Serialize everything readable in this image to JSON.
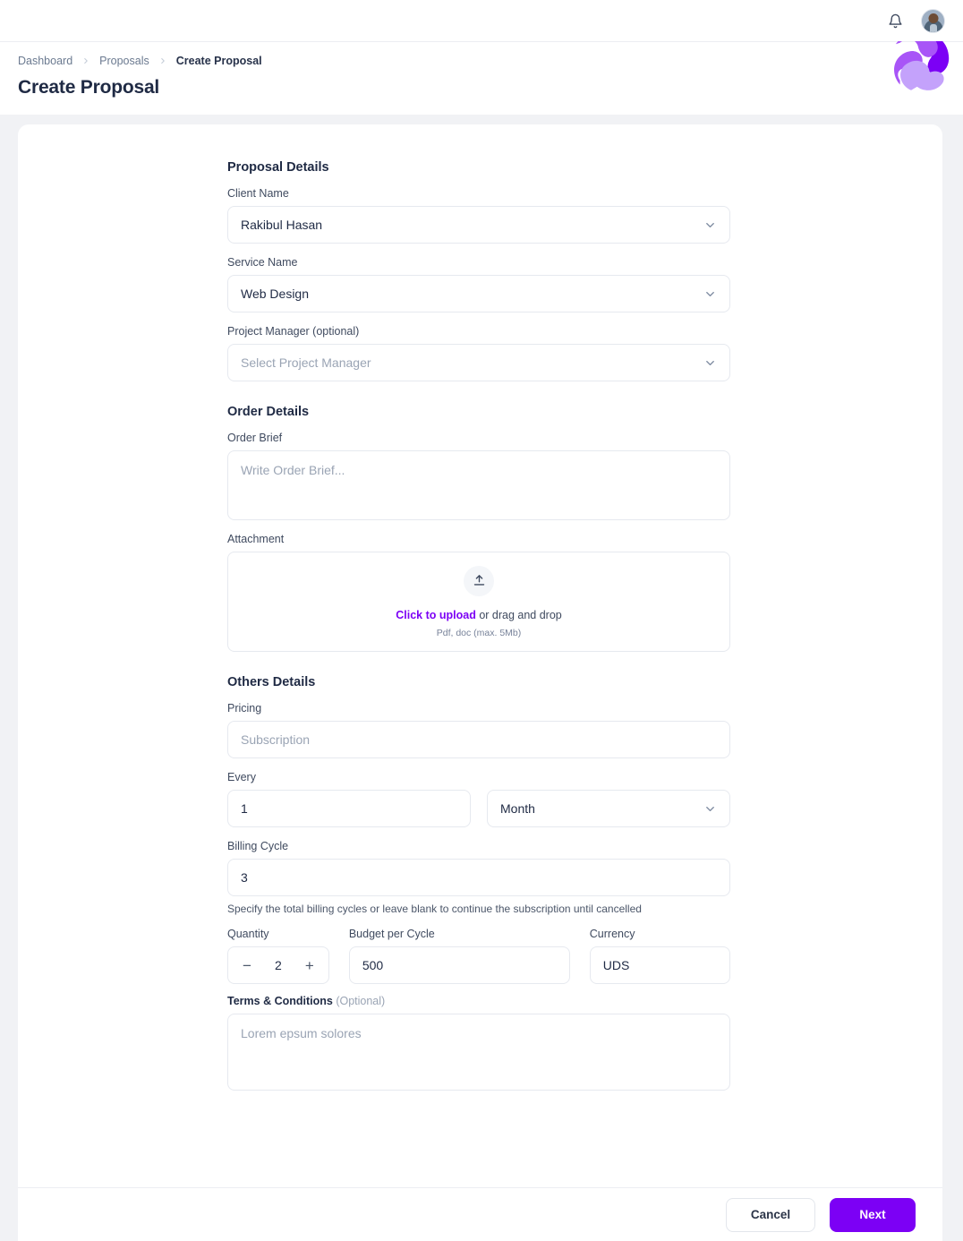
{
  "topbar": {
    "bell_icon": "bell-icon",
    "avatar_label": "user-avatar"
  },
  "header": {
    "breadcrumb": [
      {
        "label": "Dashboard",
        "current": false
      },
      {
        "label": "Proposals",
        "current": false
      },
      {
        "label": "Create Proposal",
        "current": true
      }
    ],
    "title": "Create Proposal",
    "logo": "brand-logo"
  },
  "form": {
    "proposal_details": {
      "title": "Proposal Details",
      "client_name": {
        "label": "Client Name",
        "value": "Rakibul Hasan",
        "is_placeholder": false
      },
      "service_name": {
        "label": "Service Name",
        "value": "Web Design",
        "is_placeholder": false
      },
      "project_manager": {
        "label": "Project Manager (optional)",
        "value": "Select Project Manager",
        "is_placeholder": true
      }
    },
    "order_details": {
      "title": "Order Details",
      "order_brief": {
        "label": "Order Brief",
        "placeholder": "Write Order Brief...",
        "value": ""
      },
      "attachment": {
        "label": "Attachment",
        "upload_link": "Click to upload",
        "upload_rest": " or drag and drop",
        "hint": "Pdf, doc  (max. 5Mb)",
        "icon": "upload-icon"
      }
    },
    "others_details": {
      "title": "Others Details",
      "pricing": {
        "label": "Pricing",
        "placeholder": "Subscription",
        "value": ""
      },
      "every": {
        "label": "Every",
        "count_value": "1",
        "unit_value": "Month"
      },
      "billing_cycle": {
        "label": "Billing Cycle",
        "value": "3",
        "helper": "Specify the total billing cycles or leave blank to continue the subscription until cancelled"
      },
      "quantity": {
        "label": "Quantity",
        "value": "2",
        "decrement": "−",
        "increment": "+"
      },
      "budget_per_cycle": {
        "label": "Budget per Cycle",
        "value": "500"
      },
      "currency": {
        "label": "Currency",
        "value": "UDS"
      },
      "terms": {
        "label": "Terms & Conditions ",
        "label_optional": "(Optional)",
        "placeholder": "Lorem epsum solores",
        "value": ""
      }
    }
  },
  "footer": {
    "cancel_label": "Cancel",
    "next_label": "Next"
  },
  "colors": {
    "accent_purple": "#7c00f5",
    "page_bg": "#f1f2f5",
    "text_dark": "#1f2a44",
    "text_muted": "#9aa4b4",
    "border": "#e6e9ef"
  }
}
